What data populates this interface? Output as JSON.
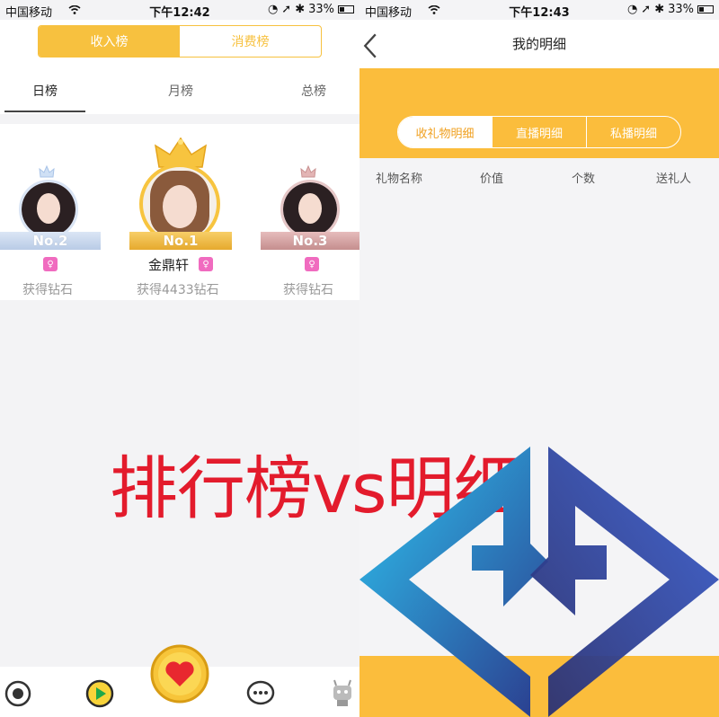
{
  "left": {
    "status": {
      "carrier": "中国移动",
      "time": "下午12:42",
      "battery": "33%"
    },
    "segment": {
      "income": "收入榜",
      "spend": "消费榜"
    },
    "tabs": {
      "day": "日榜",
      "month": "月榜",
      "total": "总榜"
    },
    "podium": {
      "second": {
        "rank": "No.2",
        "desc": "获得钻石"
      },
      "first": {
        "rank": "No.1",
        "name": "金鼎轩",
        "desc": "获得4433钻石"
      },
      "third": {
        "rank": "No.3",
        "desc": "获得钻石"
      }
    }
  },
  "right": {
    "status": {
      "carrier": "中国移动",
      "time": "下午12:43",
      "battery": "33%"
    },
    "nav": {
      "title": "我的明细"
    },
    "segment": {
      "gifts": "收礼物明细",
      "live": "直播明细",
      "private": "私播明细"
    },
    "table_headers": {
      "name": "礼物名称",
      "value": "价值",
      "count": "个数",
      "sender": "送礼人"
    }
  },
  "overlay": {
    "caption": "排行榜vs明细"
  },
  "colors": {
    "accent_yellow": "#fbbd3c",
    "caption_red": "#e31b2c",
    "badge_pink": "#f06bbf"
  }
}
